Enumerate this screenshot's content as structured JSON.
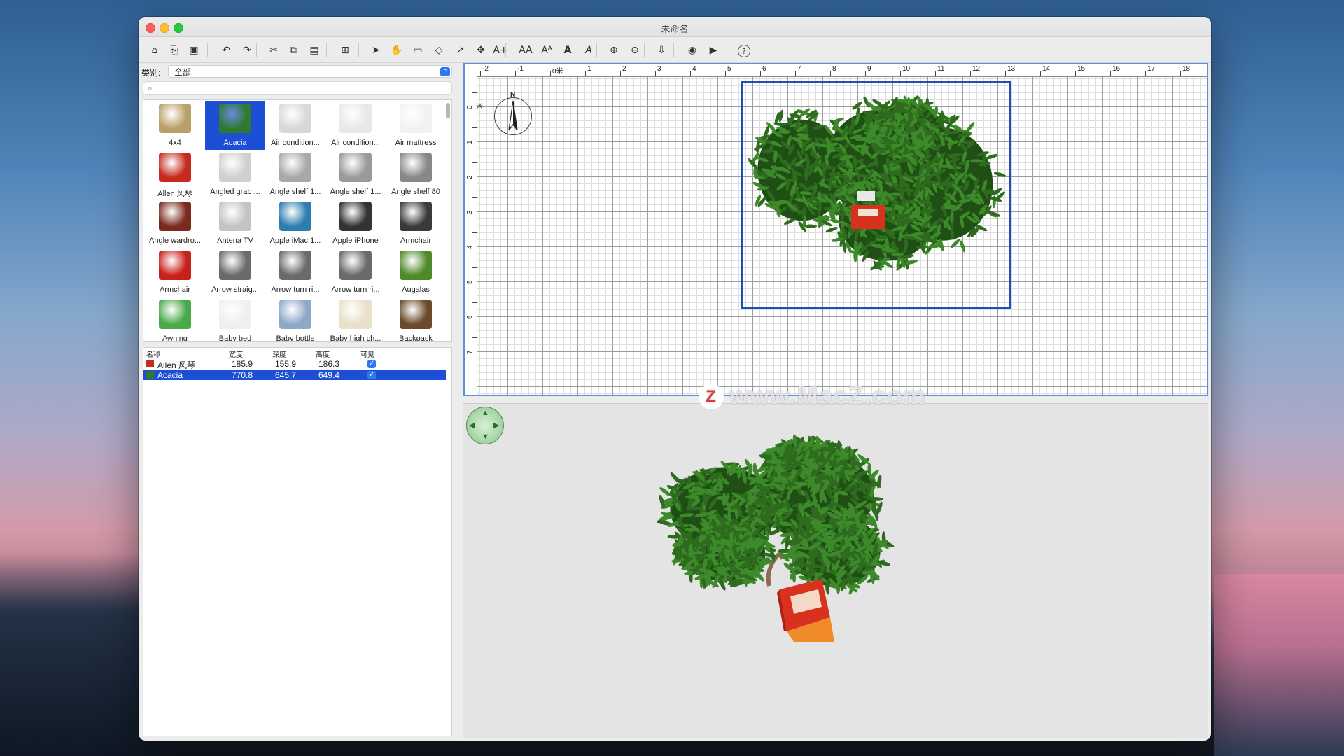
{
  "window": {
    "title": "未命名"
  },
  "toolbar": {
    "buttons": [
      {
        "name": "new-home-icon",
        "glyph": "⌂"
      },
      {
        "name": "open-icon",
        "glyph": "⎘"
      },
      {
        "name": "save-icon",
        "glyph": "▣"
      },
      {
        "name": "undo-icon",
        "glyph": "↶"
      },
      {
        "name": "redo-icon",
        "glyph": "↷"
      },
      {
        "name": "cut-icon",
        "glyph": "✂"
      },
      {
        "name": "copy-icon",
        "glyph": "⧉"
      },
      {
        "name": "paste-icon",
        "glyph": "▤"
      },
      {
        "name": "add-furniture-icon",
        "glyph": "⊞"
      },
      {
        "name": "select-mode-icon",
        "glyph": "➤"
      },
      {
        "name": "pan-mode-icon",
        "glyph": "✋"
      },
      {
        "name": "create-walls-icon",
        "glyph": "▭"
      },
      {
        "name": "create-rooms-icon",
        "glyph": "◇"
      },
      {
        "name": "create-polylines-icon",
        "glyph": "↗"
      },
      {
        "name": "create-dimensions-icon",
        "glyph": "✥"
      },
      {
        "name": "add-text-icon",
        "glyph": "A+"
      },
      {
        "name": "text-size-icon",
        "glyph": "AA"
      },
      {
        "name": "text-size-larger-icon",
        "glyph": "Aᴬ"
      },
      {
        "name": "bold-icon",
        "glyph": "A"
      },
      {
        "name": "italic-icon",
        "glyph": "A"
      },
      {
        "name": "zoom-in-icon",
        "glyph": "⊕"
      },
      {
        "name": "zoom-out-icon",
        "glyph": "⊖"
      },
      {
        "name": "import-icon",
        "glyph": "⇩"
      },
      {
        "name": "photo-icon",
        "glyph": "◉"
      },
      {
        "name": "video-icon",
        "glyph": "▶"
      },
      {
        "name": "help-icon",
        "glyph": "?"
      }
    ]
  },
  "catalog": {
    "category_label": "类别:",
    "category_value": "全部",
    "search_placeholder": "",
    "items": [
      {
        "name": "4x4",
        "color": "#b9a06a"
      },
      {
        "name": "Acacia",
        "color": "#2f7a2f"
      },
      {
        "name": "Air condition...",
        "color": "#d8d8d8"
      },
      {
        "name": "Air condition...",
        "color": "#e8e8e8"
      },
      {
        "name": "Air mattress",
        "color": "#f2f2f2"
      },
      {
        "name": "Allen 风琴",
        "color": "#c62a1e"
      },
      {
        "name": "Angled grab ...",
        "color": "#cfcfcf"
      },
      {
        "name": "Angle shelf 1...",
        "color": "#a8a8a8"
      },
      {
        "name": "Angle shelf 1...",
        "color": "#9a9a9a"
      },
      {
        "name": "Angle shelf 80",
        "color": "#888888"
      },
      {
        "name": "Angle wardro...",
        "color": "#7a2a1e"
      },
      {
        "name": "Antena TV",
        "color": "#c4c4c4"
      },
      {
        "name": "Apple iMac 1...",
        "color": "#2f7db0"
      },
      {
        "name": "Apple iPhone",
        "color": "#333333"
      },
      {
        "name": "Armchair",
        "color": "#3a3a3a"
      },
      {
        "name": "Armchair",
        "color": "#c8201a"
      },
      {
        "name": "Arrow straig...",
        "color": "#6a6a6a"
      },
      {
        "name": "Arrow turn ri...",
        "color": "#6a6a6a"
      },
      {
        "name": "Arrow turn ri...",
        "color": "#6a6a6a"
      },
      {
        "name": "Augalas",
        "color": "#4f8a2a"
      },
      {
        "name": "Awning",
        "color": "#4aaa4a"
      },
      {
        "name": "Baby bed",
        "color": "#efefef"
      },
      {
        "name": "Baby bottle",
        "color": "#8fa8c8"
      },
      {
        "name": "Baby high ch...",
        "color": "#e8e0c8"
      },
      {
        "name": "Backpack",
        "color": "#6a4a2a"
      }
    ],
    "selected_index": 1
  },
  "furniture": {
    "headers": [
      "名称",
      "宽度",
      "深度",
      "高度",
      "可见"
    ],
    "rows": [
      {
        "name": "Allen 风琴",
        "width": "185.9",
        "depth": "155.9",
        "height": "186.3",
        "visible": true,
        "selected": false,
        "color": "#c62a1e"
      },
      {
        "name": "Acacia",
        "width": "770.8",
        "depth": "645.7",
        "height": "649.4",
        "visible": true,
        "selected": true,
        "color": "#2f7a2f"
      }
    ]
  },
  "plan": {
    "x_ruler": [
      "-2",
      "-1",
      "0米",
      "1",
      "2",
      "3",
      "4",
      "5",
      "6",
      "7",
      "8",
      "9",
      "10",
      "11",
      "12",
      "13",
      "14",
      "15",
      "16",
      "17",
      "18"
    ],
    "y_ruler": [
      "0米",
      "1",
      "2",
      "3",
      "4",
      "5",
      "6",
      "7"
    ],
    "compass_label": "N"
  },
  "colors": {
    "selection": "#1d4fd6",
    "foliage": "#2f6b1f",
    "foliage_dark": "#1f4f14",
    "organ_red": "#d8321e"
  },
  "watermark": {
    "logo": "Z",
    "text": "www.MacZ.com"
  }
}
